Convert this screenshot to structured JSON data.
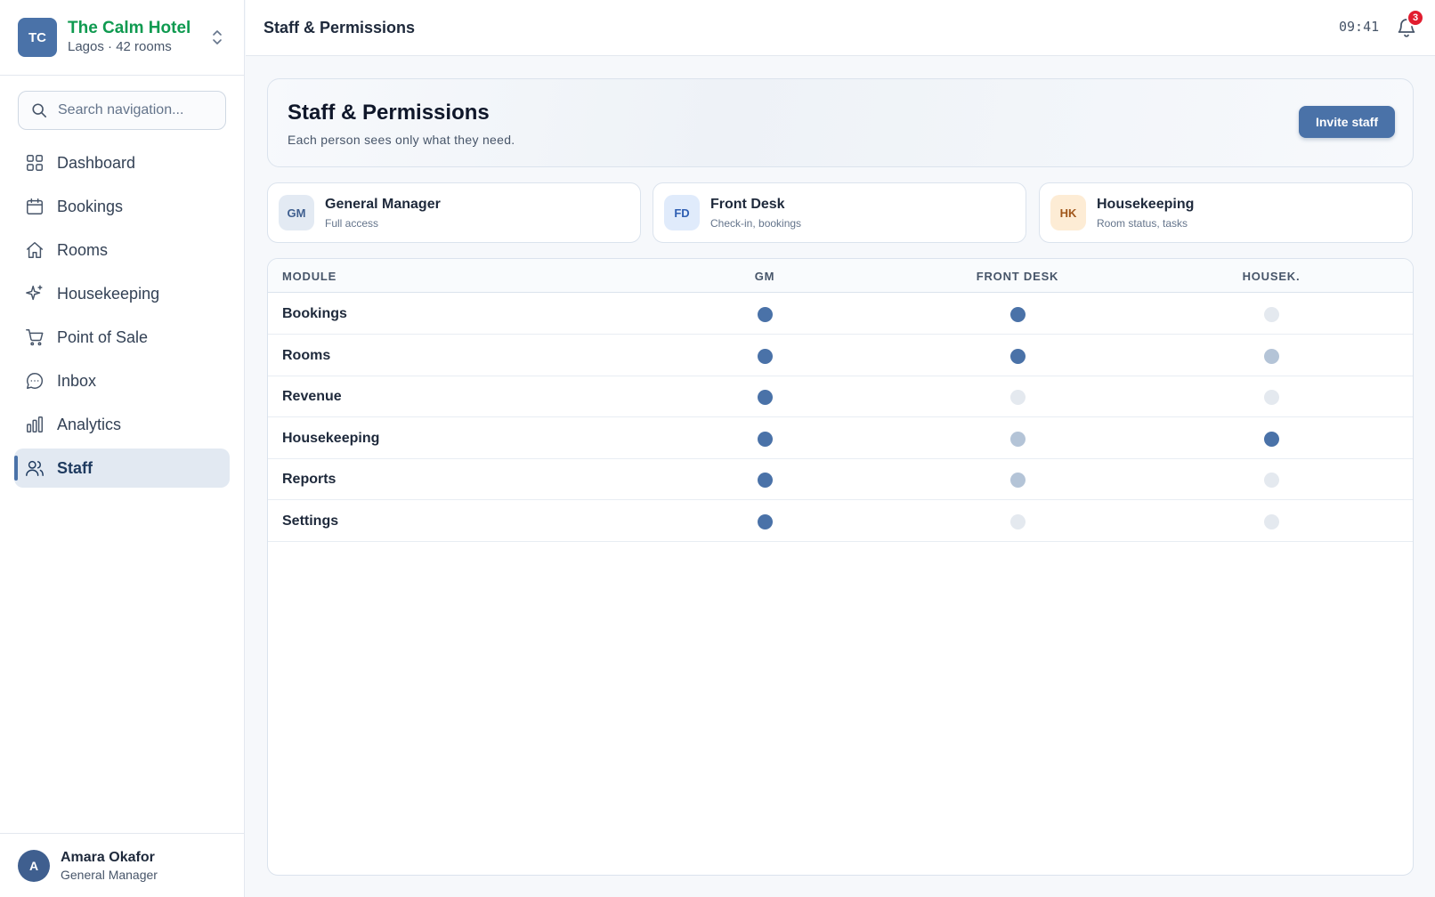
{
  "brand": {
    "initials": "TC",
    "name": "The Calm Hotel",
    "subtitle": "Lagos · 42 rooms"
  },
  "search": {
    "placeholder": "Search navigation..."
  },
  "nav": [
    {
      "label": "Dashboard",
      "icon": "grid-icon"
    },
    {
      "label": "Bookings",
      "icon": "calendar-icon"
    },
    {
      "label": "Rooms",
      "icon": "home-icon"
    },
    {
      "label": "Housekeeping",
      "icon": "sparkle-icon"
    },
    {
      "label": "Point of Sale",
      "icon": "cart-icon"
    },
    {
      "label": "Inbox",
      "icon": "chat-icon"
    },
    {
      "label": "Analytics",
      "icon": "bar-chart-icon"
    },
    {
      "label": "Staff",
      "icon": "users-icon",
      "active": true
    }
  ],
  "user": {
    "initial": "A",
    "name": "Amara Okafor",
    "role": "General Manager"
  },
  "topbar": {
    "title": "Staff & Permissions",
    "time": "09:41",
    "notifications": "3"
  },
  "header": {
    "title": "Staff & Permissions",
    "subtitle": "Each person sees only what they need.",
    "invite_label": "Invite staff"
  },
  "roles": [
    {
      "initials": "GM",
      "name": "General Manager",
      "desc": "Full access",
      "bg": "#e3eaf3",
      "fg": "#3f5f8f"
    },
    {
      "initials": "FD",
      "name": "Front Desk",
      "desc": "Check-in, bookings",
      "bg": "#e0ebfb",
      "fg": "#2f5fb3"
    },
    {
      "initials": "HK",
      "name": "Housekeeping",
      "desc": "Room status, tasks",
      "bg": "#fdecd5",
      "fg": "#a0561a"
    }
  ],
  "permissions": {
    "columns": [
      "MODULE",
      "GM",
      "FRONT DESK",
      "HOUSEK."
    ],
    "levels_legend": {
      "full": "#4a72a8",
      "partial": "#b4c4d7",
      "none": "#e4e9ef"
    },
    "rows": [
      {
        "module": "Bookings",
        "levels": [
          "full",
          "full",
          "none"
        ]
      },
      {
        "module": "Rooms",
        "levels": [
          "full",
          "full",
          "partial"
        ]
      },
      {
        "module": "Revenue",
        "levels": [
          "full",
          "none",
          "none"
        ]
      },
      {
        "module": "Housekeeping",
        "levels": [
          "full",
          "partial",
          "full"
        ]
      },
      {
        "module": "Reports",
        "levels": [
          "full",
          "partial",
          "none"
        ]
      },
      {
        "module": "Settings",
        "levels": [
          "full",
          "none",
          "none"
        ]
      }
    ]
  }
}
